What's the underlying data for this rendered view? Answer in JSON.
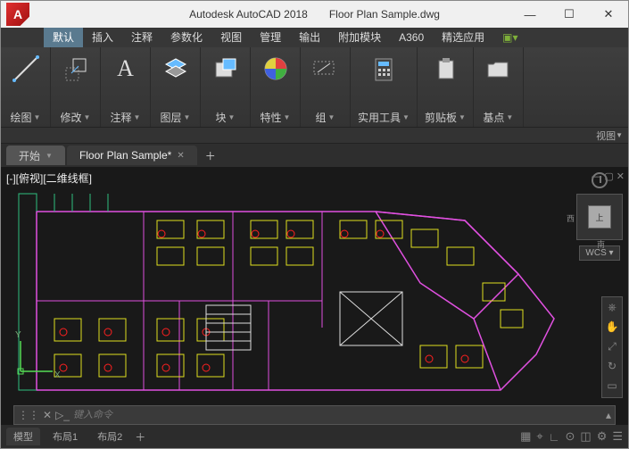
{
  "titlebar": {
    "app_name": "Autodesk AutoCAD 2018",
    "file_name": "Floor Plan Sample.dwg"
  },
  "menu": {
    "items": [
      "默认",
      "插入",
      "注释",
      "参数化",
      "视图",
      "管理",
      "输出",
      "附加模块",
      "A360",
      "精选应用"
    ],
    "active_index": 0
  },
  "ribbon": {
    "panels": [
      {
        "label": "绘图"
      },
      {
        "label": "修改"
      },
      {
        "label": "注释"
      },
      {
        "label": "图层"
      },
      {
        "label": "块"
      },
      {
        "label": "特性"
      },
      {
        "label": "组"
      },
      {
        "label": "实用工具"
      },
      {
        "label": "剪贴板"
      },
      {
        "label": "基点"
      }
    ],
    "view_switch": "视图"
  },
  "tabs": {
    "start": "开始",
    "active": "Floor Plan Sample*"
  },
  "viewport": {
    "view_label": "[-][俯视][二维线框]",
    "cube_top": "上",
    "cube_w": "西",
    "cube_s": "南",
    "wcs": "WCS",
    "ucs_x": "X",
    "ucs_y": "Y"
  },
  "cmdline": {
    "placeholder": "键入命令"
  },
  "statusbar": {
    "model": "模型",
    "layout1": "布局1",
    "layout2": "布局2"
  }
}
